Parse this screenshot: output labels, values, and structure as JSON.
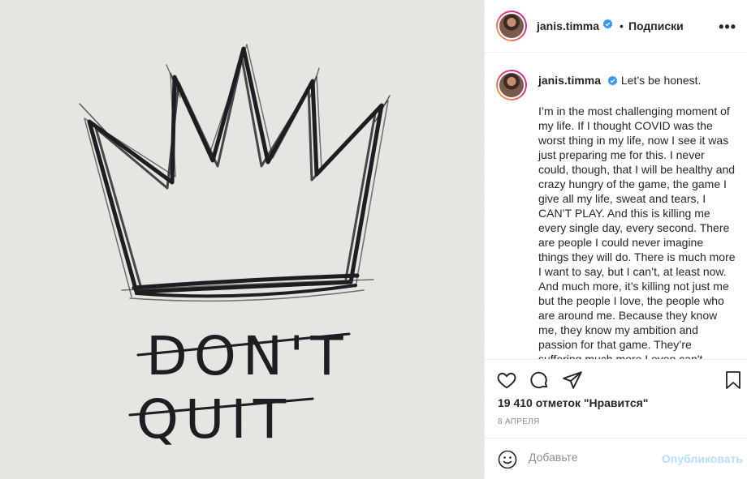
{
  "photo": {
    "top_word": "DON'T",
    "bottom_word": "QUIT"
  },
  "header": {
    "username": "janis.timma",
    "separator": "•",
    "follow_label": "Подписки",
    "more_label": "•••"
  },
  "caption": {
    "username": "janis.timma",
    "first_line": "Let’s be honest.",
    "body": "I’m in the most challenging moment of my life. If I thought COVID was the worst thing in my life, now I see it was just preparing me for this. I never could, though, that I will be healthy and crazy hungry of the game, the game I give all my life, sweat and tears, I CAN’T PLAY. And this is killing me every single day, every second. There are people I could never imagine things they will do. There is much more I want to say, but I can’t, at least now. And much more, it’s killing not just me but the people I love, the people who are around me. Because they know me, they know my ambition and passion for that game. They’re suffering much more I even can't imagine."
  },
  "stats": {
    "likes": "19 410 отметок \"Нравится\"",
    "date": "8 АПРЕЛЯ"
  },
  "comment": {
    "placeholder": "Добавьте",
    "post_label": "Опубликовать"
  },
  "colors": {
    "accent_disabled": "#b2dffc",
    "verified": "#3897f0",
    "muted": "#8e8e8e"
  }
}
